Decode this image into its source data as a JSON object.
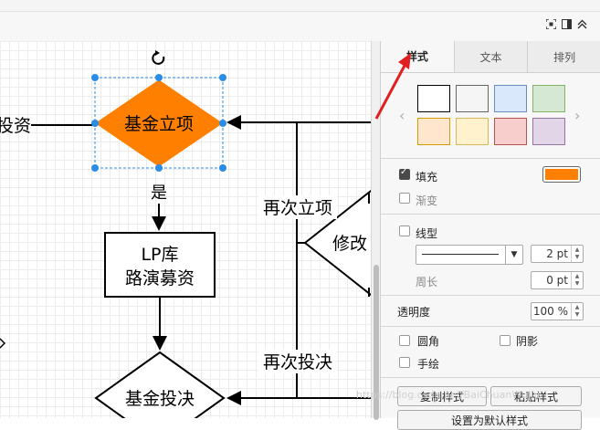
{
  "diagram": {
    "selected_node": "基金立项",
    "node_lp": [
      "LP库",
      "路演募资"
    ],
    "node_vote": "基金投决",
    "edge_yes": "是",
    "edge_relaunch": "再次立项",
    "edge_modify": "修改",
    "edge_revote": "再次投决",
    "cut_label_left": "投资",
    "fill_color": "#ff8000"
  },
  "panel": {
    "tabs": [
      "样式",
      "文本",
      "排列"
    ],
    "active_tab": "样式",
    "swatch_colors": [
      "#ffffff",
      "#f5f5f5",
      "#dae8fc",
      "#d5e8d4",
      "#ffe6cc",
      "#fff2cc",
      "#f8cecc",
      "#e1d5e7"
    ],
    "swatch_borders": [
      "#000000",
      "#666666",
      "#6c8ebf",
      "#82b366",
      "#d79b00",
      "#d6b656",
      "#b85450",
      "#9673a6"
    ],
    "fill_label": "填充",
    "fill_checked": true,
    "fill_color": "#ff8000",
    "gradient_label": "渐变",
    "gradient_checked": false,
    "line_label": "线型",
    "line_checked": false,
    "line_width": "2 pt",
    "perimeter_label": "周长",
    "perimeter_value": "0 pt",
    "opacity_label": "透明度",
    "opacity_value": "100 %",
    "rounded_label": "圆角",
    "shadow_label": "阴影",
    "sketch_label": "手绘",
    "copy_style_label": "复制样式",
    "paste_style_label": "粘贴样式",
    "default_style_label": "设置为默认样式"
  },
  "watermark": "https://blog.csdn.net/BaiChuanWuJiu"
}
